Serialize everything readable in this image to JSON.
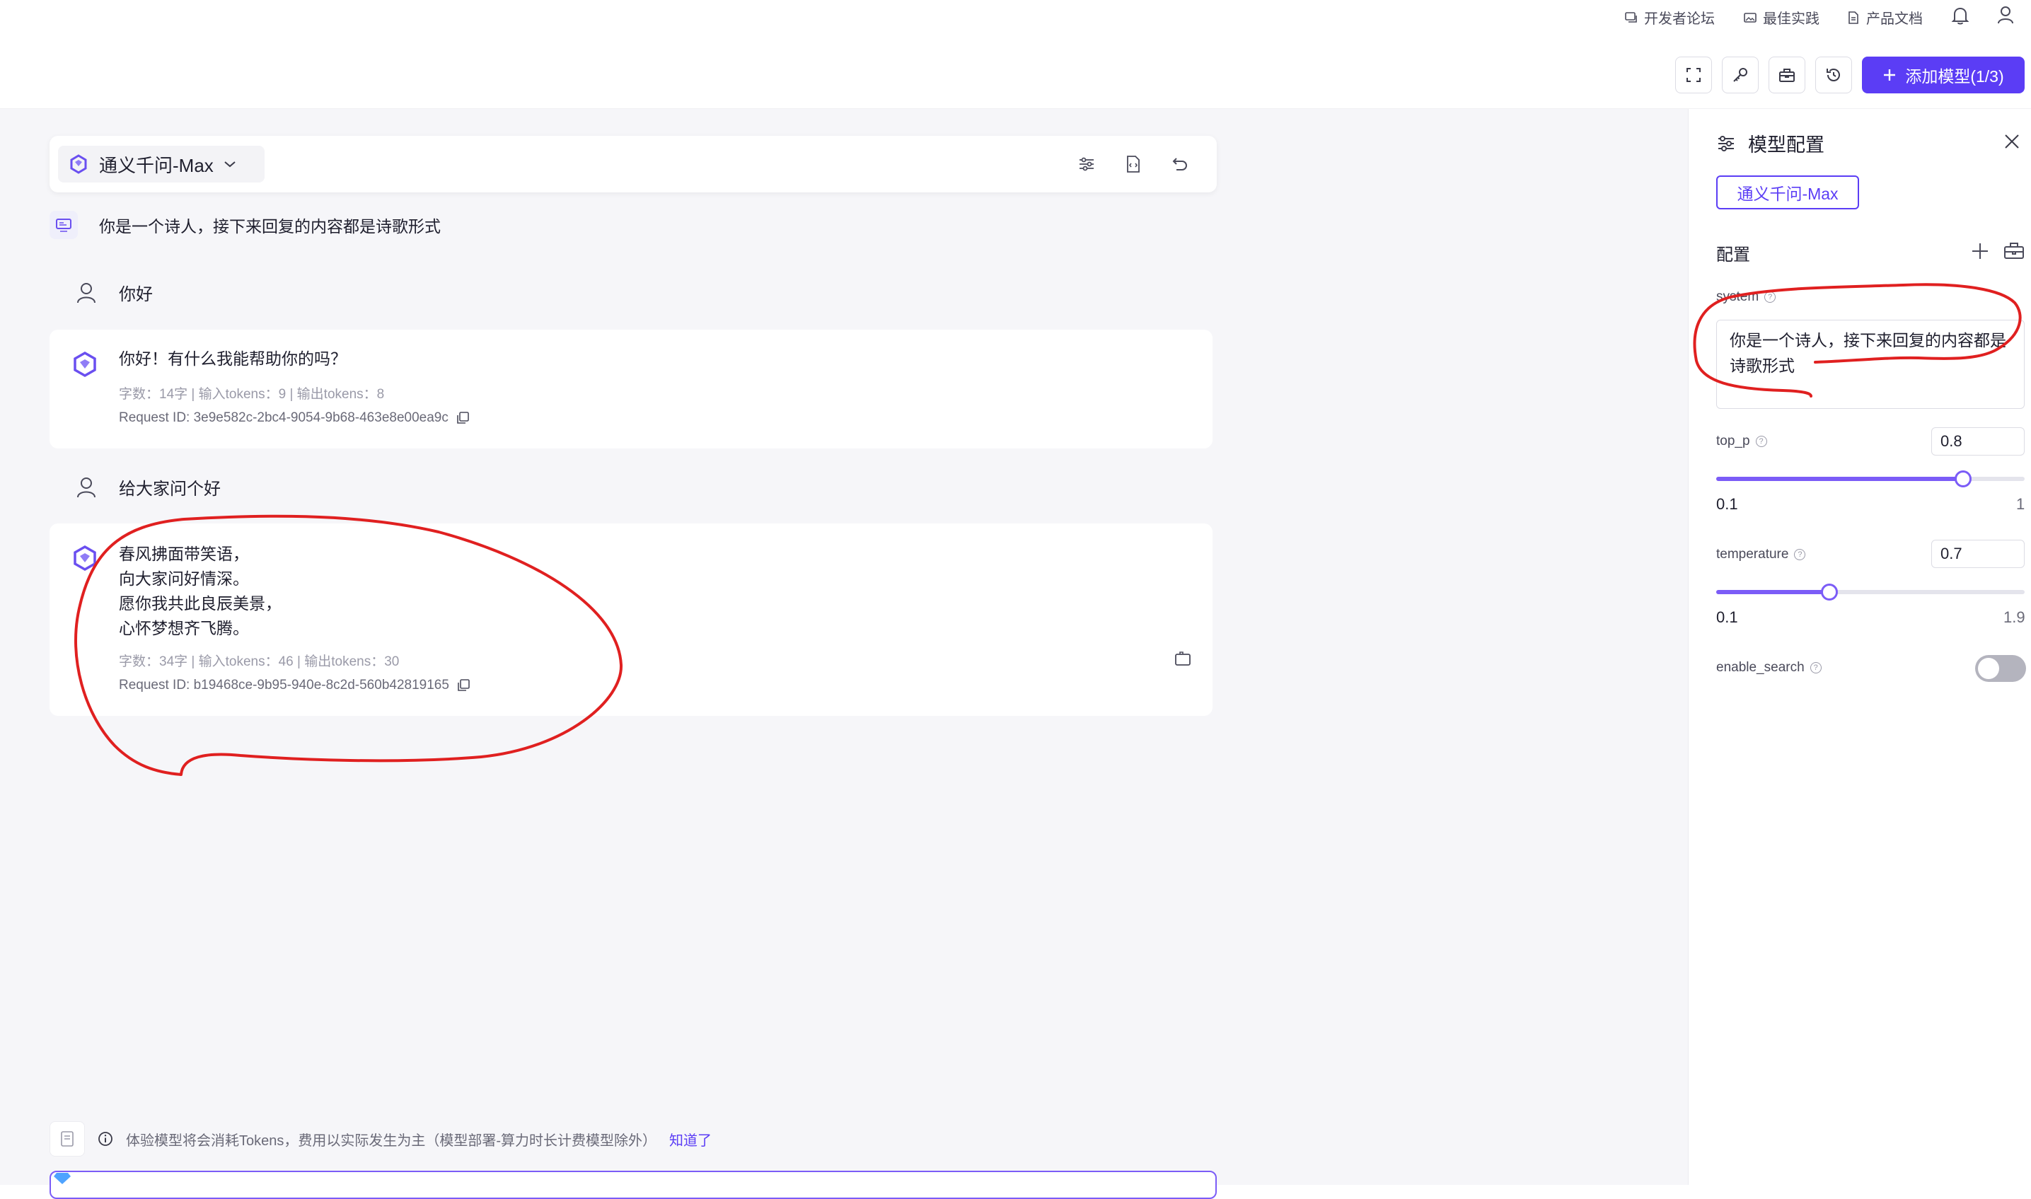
{
  "nav": {
    "links": [
      {
        "label": "开发者论坛",
        "icon": "forum-icon"
      },
      {
        "label": "最佳实践",
        "icon": "image-icon"
      },
      {
        "label": "产品文档",
        "icon": "doc-icon"
      }
    ],
    "bell_icon": "bell-icon",
    "user_icon": "user-icon"
  },
  "toolbar": {
    "icons": [
      "fullscreen-icon",
      "key-icon",
      "toolbox-icon",
      "history-icon"
    ],
    "add_model_label": "添加模型(1/3)"
  },
  "model_bar": {
    "model_name": "通义千问-Max",
    "icons": [
      "settings-sliders-icon",
      "code-file-icon",
      "undo-icon"
    ]
  },
  "chat": {
    "system_prompt": "你是一个诗人，接下来回复的内容都是诗歌形式",
    "messages": [
      {
        "role": "user",
        "text": "你好"
      },
      {
        "role": "assistant",
        "lines": [
          "你好！有什么我能帮助你的吗？"
        ],
        "meta": "字数：14字 | 输入tokens：9 | 输出tokens：8",
        "request_id": "Request ID: 3e9e582c-2bc4-9054-9b68-463e8e00ea9c"
      },
      {
        "role": "user",
        "text": "给大家问个好"
      },
      {
        "role": "assistant",
        "lines": [
          "春风拂面带笑语，",
          "向大家问好情深。",
          "愿你我共此良辰美景，",
          "心怀梦想齐飞腾。"
        ],
        "meta": "字数：34字 | 输入tokens：46 | 输出tokens：30",
        "request_id": "Request ID: b19468ce-9b95-940e-8c2d-560b42819165"
      }
    ]
  },
  "notice": {
    "text": "体验模型将会消耗Tokens，费用以实际发生为主（模型部署-算力时长计费模型除外）",
    "link": "知道了"
  },
  "panel": {
    "title": "模型配置",
    "model_chip": "通义千问-Max",
    "section_title": "配置",
    "system_label": "system",
    "system_value": "你是一个诗人，接下来回复的内容都是诗歌形式",
    "top_p": {
      "label": "top_p",
      "value": "0.8",
      "min": "0.1",
      "max": "1",
      "level": 0.8
    },
    "temperature": {
      "label": "temperature",
      "value": "0.7",
      "min": "0.1",
      "max": "1.9",
      "level": 0.368
    },
    "enable_search": {
      "label": "enable_search",
      "on": false
    }
  },
  "colors": {
    "accent": "#5b3df5",
    "annotation": "#e02020",
    "background": "#f6f6f9"
  }
}
